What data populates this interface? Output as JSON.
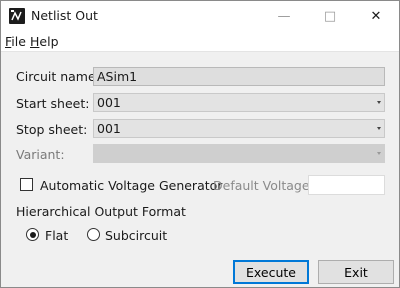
{
  "window": {
    "title": "Netlist Out"
  },
  "titlebar_controls": {
    "minimize": "—",
    "maximize": "□",
    "close": "✕"
  },
  "menu": {
    "file": {
      "mnemonic": "F",
      "rest": "ile"
    },
    "help": {
      "mnemonic": "H",
      "rest": "elp"
    }
  },
  "form": {
    "circuit_name_label": "Circuit name:",
    "circuit_name_value": "ASim1",
    "start_sheet_label": "Start sheet:",
    "start_sheet_value": "001",
    "stop_sheet_label": "Stop sheet:",
    "stop_sheet_value": "001",
    "variant_label": "Variant:",
    "variant_value": ""
  },
  "voltage": {
    "checkbox_label": "Automatic Voltage Generator",
    "checked": false,
    "default_voltage_label": "Default Voltage:",
    "default_voltage_value": ""
  },
  "output_format": {
    "heading": "Hierarchical Output Format",
    "flat_label": "Flat",
    "subcircuit_label": "Subcircuit",
    "selected": "Flat"
  },
  "buttons": {
    "execute": "Execute",
    "exit": "Exit"
  },
  "icons": {
    "app": "netlist-app-icon",
    "dropdown": "chevron-down-icon"
  }
}
